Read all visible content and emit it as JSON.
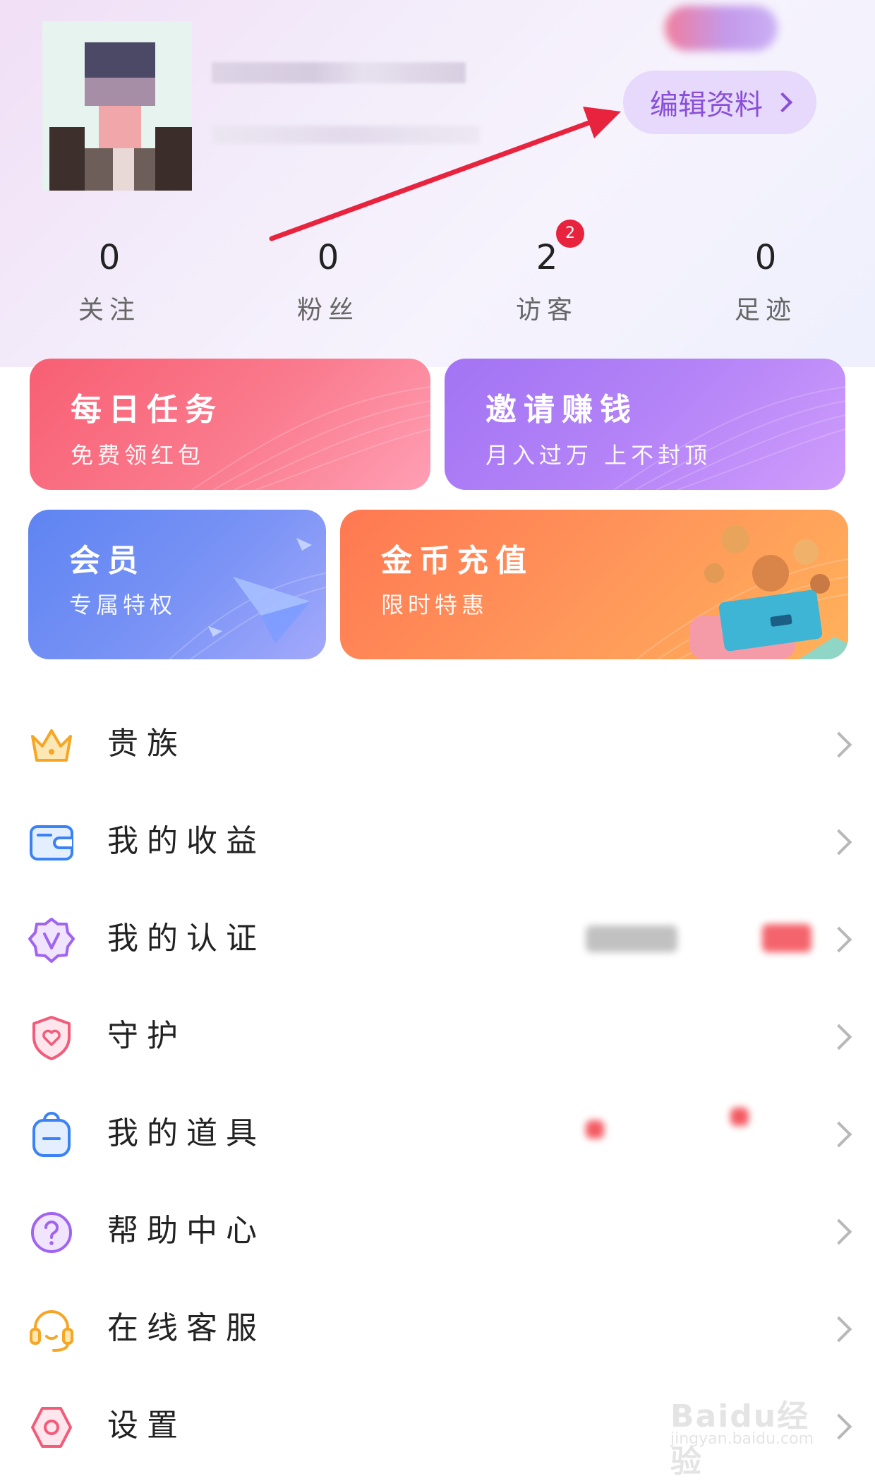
{
  "header": {
    "edit_profile_label": "编辑资料"
  },
  "stats": [
    {
      "value": "0",
      "label": "关注"
    },
    {
      "value": "0",
      "label": "粉丝"
    },
    {
      "value": "2",
      "label": "访客",
      "badge": "2"
    },
    {
      "value": "0",
      "label": "足迹"
    }
  ],
  "cards": {
    "daily_task": {
      "title": "每日任务",
      "subtitle": "免费领红包"
    },
    "invite": {
      "title": "邀请赚钱",
      "subtitle": "月入过万 上不封顶"
    },
    "vip": {
      "title": "会员",
      "subtitle": "专属特权"
    },
    "coin": {
      "title": "金币充值",
      "subtitle": "限时特惠"
    }
  },
  "menu": [
    {
      "label": "贵族",
      "icon": "crown-icon"
    },
    {
      "label": "我的收益",
      "icon": "wallet-icon"
    },
    {
      "label": "我的认证",
      "icon": "verified-badge-icon"
    },
    {
      "label": "守护",
      "icon": "shield-heart-icon"
    },
    {
      "label": "我的道具",
      "icon": "backpack-icon"
    },
    {
      "label": "帮助中心",
      "icon": "help-icon"
    },
    {
      "label": "在线客服",
      "icon": "headset-icon"
    },
    {
      "label": "设置",
      "icon": "settings-icon"
    }
  ],
  "watermark": {
    "brand": "Baidu经验",
    "url": "jingyan.baidu.com"
  },
  "colors": {
    "accent_purple": "#8a4fd8",
    "edit_button_bg": "#e6d9fb",
    "arrow_red": "#e8233d",
    "daily_card": "#f85f73",
    "invite_card": "#a274f4",
    "vip_card": "#5e84f2",
    "coin_card": "#ff7852"
  }
}
